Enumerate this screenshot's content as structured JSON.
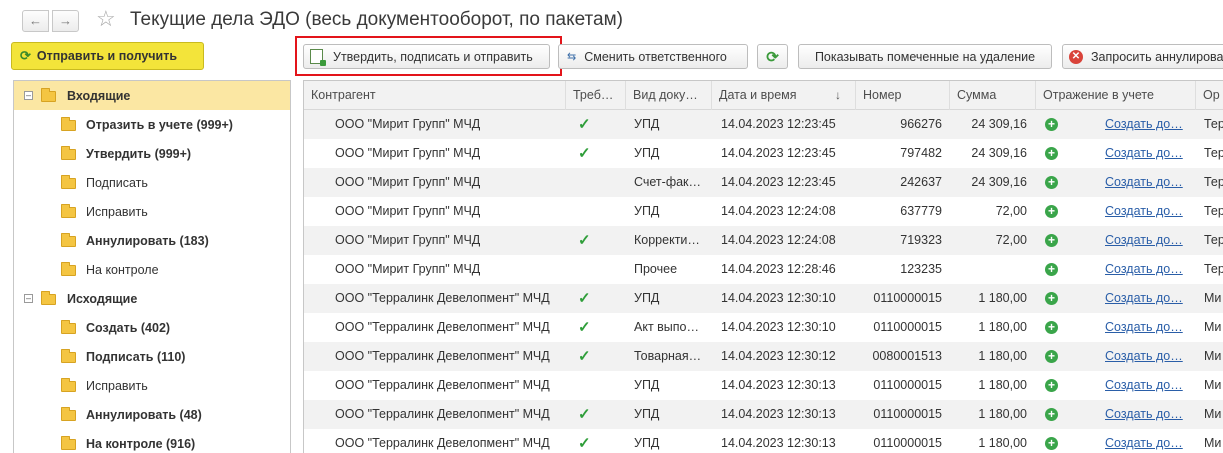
{
  "window": {
    "title": "Текущие дела ЭДО (весь документооборот, по пакетам)",
    "back_icon": "arrow-left-icon",
    "forward_icon": "arrow-right-icon",
    "favorite_icon": "star-icon"
  },
  "toolbar": {
    "send_receive": "Отправить и получить",
    "approve_sign_send": "Утвердить, подписать и отправить",
    "change_responsible": "Сменить ответственного",
    "show_marked": "Показывать помеченные на удаление",
    "request_annul": "Запросить аннулирова"
  },
  "tree": {
    "incoming": {
      "label": "Входящие",
      "items": [
        {
          "label": "Отразить в учете (999+)",
          "bold": true
        },
        {
          "label": "Утвердить (999+)",
          "bold": true
        },
        {
          "label": "Подписать",
          "bold": false
        },
        {
          "label": "Исправить",
          "bold": false
        },
        {
          "label": "Аннулировать (183)",
          "bold": true
        },
        {
          "label": "На контроле",
          "bold": false
        }
      ]
    },
    "outgoing": {
      "label": "Исходящие",
      "items": [
        {
          "label": "Создать (402)",
          "bold": true
        },
        {
          "label": "Подписать (110)",
          "bold": true
        },
        {
          "label": "Исправить",
          "bold": false
        },
        {
          "label": "Аннулировать (48)",
          "bold": true
        },
        {
          "label": "На контроле (916)",
          "bold": true
        }
      ]
    }
  },
  "grid": {
    "columns": [
      "Контрагент",
      "Треб…",
      "Вид доку…",
      "Дата и время",
      "Номер",
      "Сумма",
      "Отражение в учете",
      "Ор"
    ],
    "sort_indicator": "↓",
    "rows": [
      {
        "counterparty": "ООО \"Мирит Групп\" МЧД",
        "required": true,
        "doc_type": "УПД",
        "datetime": "14.04.2023 12:23:45",
        "number": "966276",
        "sum": "24 309,16",
        "action": "Создать до…",
        "org": "Тер"
      },
      {
        "counterparty": "ООО \"Мирит Групп\" МЧД",
        "required": true,
        "doc_type": "УПД",
        "datetime": "14.04.2023 12:23:45",
        "number": "797482",
        "sum": "24 309,16",
        "action": "Создать до…",
        "org": "Тер"
      },
      {
        "counterparty": "ООО \"Мирит Групп\" МЧД",
        "required": false,
        "doc_type": "Счет-фак…",
        "datetime": "14.04.2023 12:23:45",
        "number": "242637",
        "sum": "24 309,16",
        "action": "Создать до…",
        "org": "Тер"
      },
      {
        "counterparty": "ООО \"Мирит Групп\" МЧД",
        "required": false,
        "doc_type": "УПД",
        "datetime": "14.04.2023 12:24:08",
        "number": "637779",
        "sum": "72,00",
        "action": "Создать до…",
        "org": "Тер"
      },
      {
        "counterparty": "ООО \"Мирит Групп\" МЧД",
        "required": true,
        "doc_type": "Корректи…",
        "datetime": "14.04.2023 12:24:08",
        "number": "719323",
        "sum": "72,00",
        "action": "Создать до…",
        "org": "Тер"
      },
      {
        "counterparty": "ООО \"Мирит Групп\" МЧД",
        "required": false,
        "doc_type": "Прочее",
        "datetime": "14.04.2023 12:28:46",
        "number": "123235",
        "sum": "",
        "action": "Создать до…",
        "org": "Тер"
      },
      {
        "counterparty": "ООО \"Терралинк Девелопмент\" МЧД",
        "required": true,
        "doc_type": "УПД",
        "datetime": "14.04.2023 12:30:10",
        "number": "0110000015",
        "sum": "1 180,00",
        "action": "Создать до…",
        "org": "Ми"
      },
      {
        "counterparty": "ООО \"Терралинк Девелопмент\" МЧД",
        "required": true,
        "doc_type": "Акт выпо…",
        "datetime": "14.04.2023 12:30:10",
        "number": "0110000015",
        "sum": "1 180,00",
        "action": "Создать до…",
        "org": "Ми"
      },
      {
        "counterparty": "ООО \"Терралинк Девелопмент\" МЧД",
        "required": true,
        "doc_type": "Товарная…",
        "datetime": "14.04.2023 12:30:12",
        "number": "0080001513",
        "sum": "1 180,00",
        "action": "Создать до…",
        "org": "Ми"
      },
      {
        "counterparty": "ООО \"Терралинк Девелопмент\" МЧД",
        "required": false,
        "doc_type": "УПД",
        "datetime": "14.04.2023 12:30:13",
        "number": "0110000015",
        "sum": "1 180,00",
        "action": "Создать до…",
        "org": "Ми"
      },
      {
        "counterparty": "ООО \"Терралинк Девелопмент\" МЧД",
        "required": true,
        "doc_type": "УПД",
        "datetime": "14.04.2023 12:30:13",
        "number": "0110000015",
        "sum": "1 180,00",
        "action": "Создать до…",
        "org": "Ми"
      },
      {
        "counterparty": "ООО \"Терралинк Девелопмент\" МЧД",
        "required": true,
        "doc_type": "УПД",
        "datetime": "14.04.2023 12:30:13",
        "number": "0110000015",
        "sum": "1 180,00",
        "action": "Создать до…",
        "org": "Ми"
      }
    ]
  },
  "colors": {
    "send_button": "#f3e43a",
    "highlight_box": "#e3141a",
    "selected_tree_row": "#fbe7a3",
    "check": "#2f9e3a",
    "link": "#2a5ea8"
  }
}
